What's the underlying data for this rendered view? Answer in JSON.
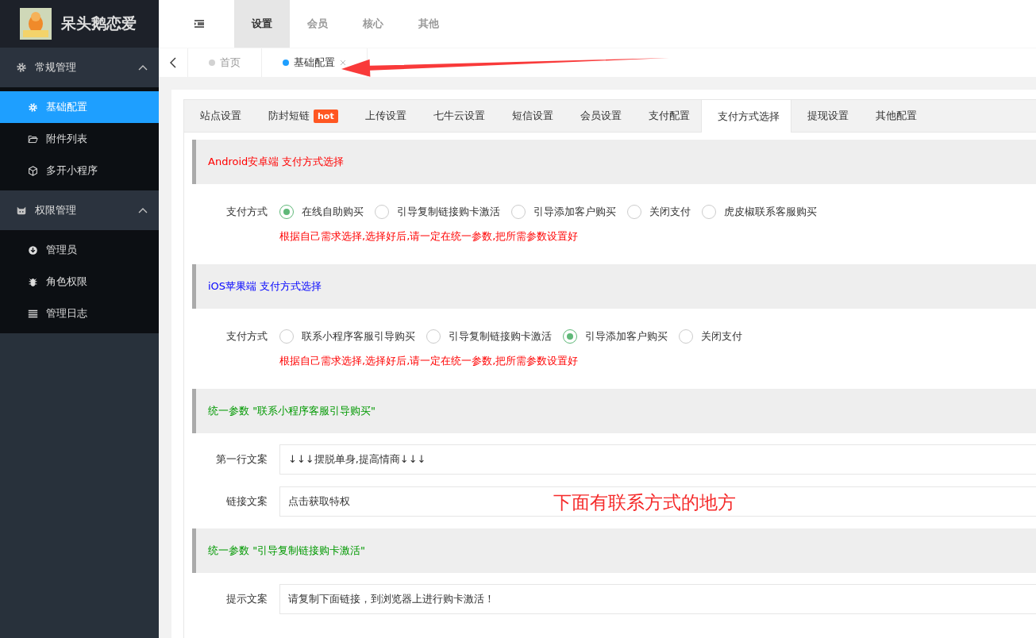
{
  "brand": {
    "name": "呆头鹅恋爱"
  },
  "sidebar": {
    "groups": [
      {
        "label": "常规管理",
        "expanded": true,
        "items": [
          {
            "label": "基础配置",
            "selected": true
          },
          {
            "label": "附件列表",
            "selected": false
          },
          {
            "label": "多开小程序",
            "selected": false
          }
        ]
      },
      {
        "label": "权限管理",
        "expanded": true,
        "items": [
          {
            "label": "管理员",
            "selected": false
          },
          {
            "label": "角色权限",
            "selected": false
          },
          {
            "label": "管理日志",
            "selected": false
          }
        ]
      }
    ]
  },
  "top_nav": [
    {
      "label": "设置",
      "selected": true
    },
    {
      "label": "会员",
      "selected": false
    },
    {
      "label": "核心",
      "selected": false
    },
    {
      "label": "其他",
      "selected": false
    }
  ],
  "page_tabs": [
    {
      "label": "首页",
      "selected": false
    },
    {
      "label": "基础配置",
      "selected": true
    }
  ],
  "config_tabs": [
    {
      "label": "站点设置",
      "selected": false
    },
    {
      "label": "防封短链",
      "selected": false,
      "badge": "hot"
    },
    {
      "label": "上传设置",
      "selected": false
    },
    {
      "label": "七牛云设置",
      "selected": false
    },
    {
      "label": "短信设置",
      "selected": false
    },
    {
      "label": "会员设置",
      "selected": false
    },
    {
      "label": "支付配置",
      "selected": false
    },
    {
      "label": "支付方式选择",
      "selected": true
    },
    {
      "label": "提现设置",
      "selected": false
    },
    {
      "label": "其他配置",
      "selected": false
    }
  ],
  "sections": [
    {
      "title": "Android安卓端 支付方式选择",
      "color": "#ff0000",
      "kind": "radio",
      "label": "支付方式",
      "options": [
        {
          "label": "在线自助购买",
          "selected": true
        },
        {
          "label": "引导复制链接购卡激活",
          "selected": false
        },
        {
          "label": "引导添加客户购买",
          "selected": false
        },
        {
          "label": "关闭支付",
          "selected": false
        },
        {
          "label": "虎皮椒联系客服购买",
          "selected": false
        }
      ],
      "hint": "根据自己需求选择,选择好后,请一定在统一参数,把所需参数设置好"
    },
    {
      "title": "iOS苹果端 支付方式选择",
      "color": "#0000ff",
      "kind": "radio",
      "label": "支付方式",
      "options": [
        {
          "label": "联系小程序客服引导购买",
          "selected": false
        },
        {
          "label": "引导复制链接购卡激活",
          "selected": false
        },
        {
          "label": "引导添加客户购买",
          "selected": true
        },
        {
          "label": "关闭支付",
          "selected": false
        }
      ],
      "hint": "根据自己需求选择,选择好后,请一定在统一参数,把所需参数设置好"
    },
    {
      "title": "统一参数 \"联系小程序客服引导购买\"",
      "color": "#009900",
      "kind": "fields",
      "fields": [
        {
          "label": "第一行文案",
          "value": "↓↓↓摆脱单身,提高情商↓↓↓"
        },
        {
          "label": "链接文案",
          "value": "点击获取特权"
        }
      ]
    },
    {
      "title": "统一参数 \"引导复制链接购卡激活\"",
      "color": "#009900",
      "kind": "fields",
      "fields": [
        {
          "label": "提示文案",
          "value": "请复制下面链接，到浏览器上进行购卡激活！"
        }
      ]
    }
  ],
  "annotation": {
    "text": "下面有联系方式的地方"
  }
}
